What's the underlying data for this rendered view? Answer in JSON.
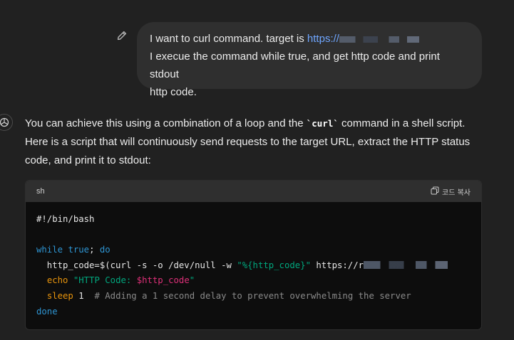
{
  "user_message": {
    "line1_prefix": "I want to curl command. target is ",
    "line1_link": "https://",
    "line2": "I execue the command while true, and get http code and print stdout",
    "line3": "http code."
  },
  "assistant": {
    "para_part1": "You can achieve this using a combination of a loop and the ",
    "inline_code": "`curl`",
    "para_part2": " command in a shell script. Here is a script that will continuously send requests to the target URL, extract the HTTP status code, and print it to stdout:"
  },
  "code_block": {
    "language": "sh",
    "copy_label": "코드 복사",
    "lines": {
      "shebang": "#!/bin/bash",
      "while_kw": "while",
      "true_kw": "true",
      "semicolon": ";",
      "do_kw": "do",
      "l3_a": "  http_code=$(curl -s -o /dev/null -w ",
      "l3_str": "\"%{http_code}\"",
      "l3_b": " https://r",
      "echo_kw": "echo",
      "echo_str_a": "\"HTTP Code: ",
      "echo_var": "$http_code",
      "echo_str_b": "\"",
      "sleep_kw": "sleep",
      "sleep_num": " 1  ",
      "comment": "# Adding a 1 second delay to prevent overwhelming the server",
      "done_kw": "done"
    }
  },
  "icons": {
    "edit": "pencil-icon",
    "avatar": "chatgpt-logo-icon",
    "copy": "copy-icon"
  },
  "colors": {
    "background": "#212121",
    "user_bubble": "#2f2f2f",
    "code_bg": "#0d0d0d",
    "link": "#6fa6ff",
    "keyword": "#2e95d3",
    "string": "#00a67d",
    "variable": "#df3079",
    "builtin": "#e9950c",
    "comment": "#8a8a8a"
  }
}
